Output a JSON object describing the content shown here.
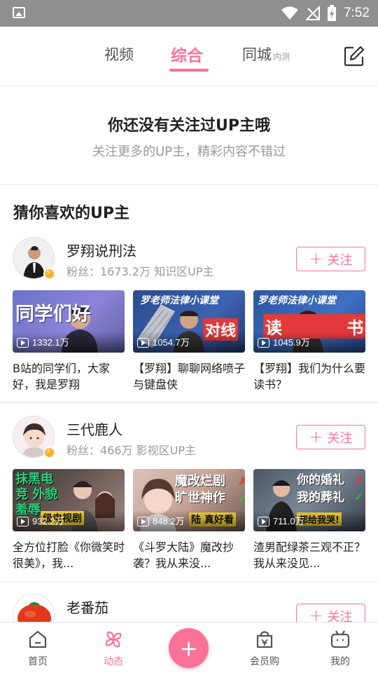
{
  "status_bar": {
    "time": "7:52"
  },
  "top_nav": {
    "tabs": [
      {
        "label": "视频"
      },
      {
        "label": "综合"
      },
      {
        "label": "同城",
        "sub": "内测"
      }
    ],
    "active_tab": "综合"
  },
  "empty_state": {
    "title": "你还没有关注过UP主哦",
    "subtitle": "关注更多的UP主，精彩内容不错过"
  },
  "section_title": "猜你喜欢的UP主",
  "follow_label": "关注",
  "ups": [
    {
      "name": "罗翔说刑法",
      "meta": "粉丝：1673.2万 知识区UP主",
      "videos": [
        {
          "views": "1332.1万",
          "title": "B站的同学们，大家好，我是罗翔",
          "caption": "同学们好"
        },
        {
          "views": "1054.7万",
          "title": "【罗翔】聊聊网络喷子与键盘侠",
          "caption": "对线"
        },
        {
          "views": "1045.9万",
          "title": "【罗翔】我们为什么要读书？",
          "caption": "读 书"
        }
      ]
    },
    {
      "name": "三代鹿人",
      "meta": "粉丝：466万 影视区UP主",
      "videos": [
        {
          "views": "932.2万",
          "title": "全方位打脸《你微笑时很美》，我...",
          "caption": "抹黑电竞 外貌羞辱"
        },
        {
          "views": "848.2万",
          "title": "《斗罗大陆》魔改抄袭？我从来没...",
          "caption": "魔改烂剧 旷世神作"
        },
        {
          "views": "711.0万",
          "title": "渣男配绿茶三观不正？我从来没见...",
          "caption": "你的婚礼 我的葬礼"
        }
      ]
    },
    {
      "name": "老番茄"
    }
  ],
  "bottom_nav": {
    "items": [
      {
        "label": "首页"
      },
      {
        "label": "动态"
      },
      {
        "label": "会员购"
      },
      {
        "label": "我的"
      }
    ],
    "active": "动态"
  },
  "colors": {
    "accent": "#fb7299",
    "status_bar": "#8f8f8f"
  }
}
